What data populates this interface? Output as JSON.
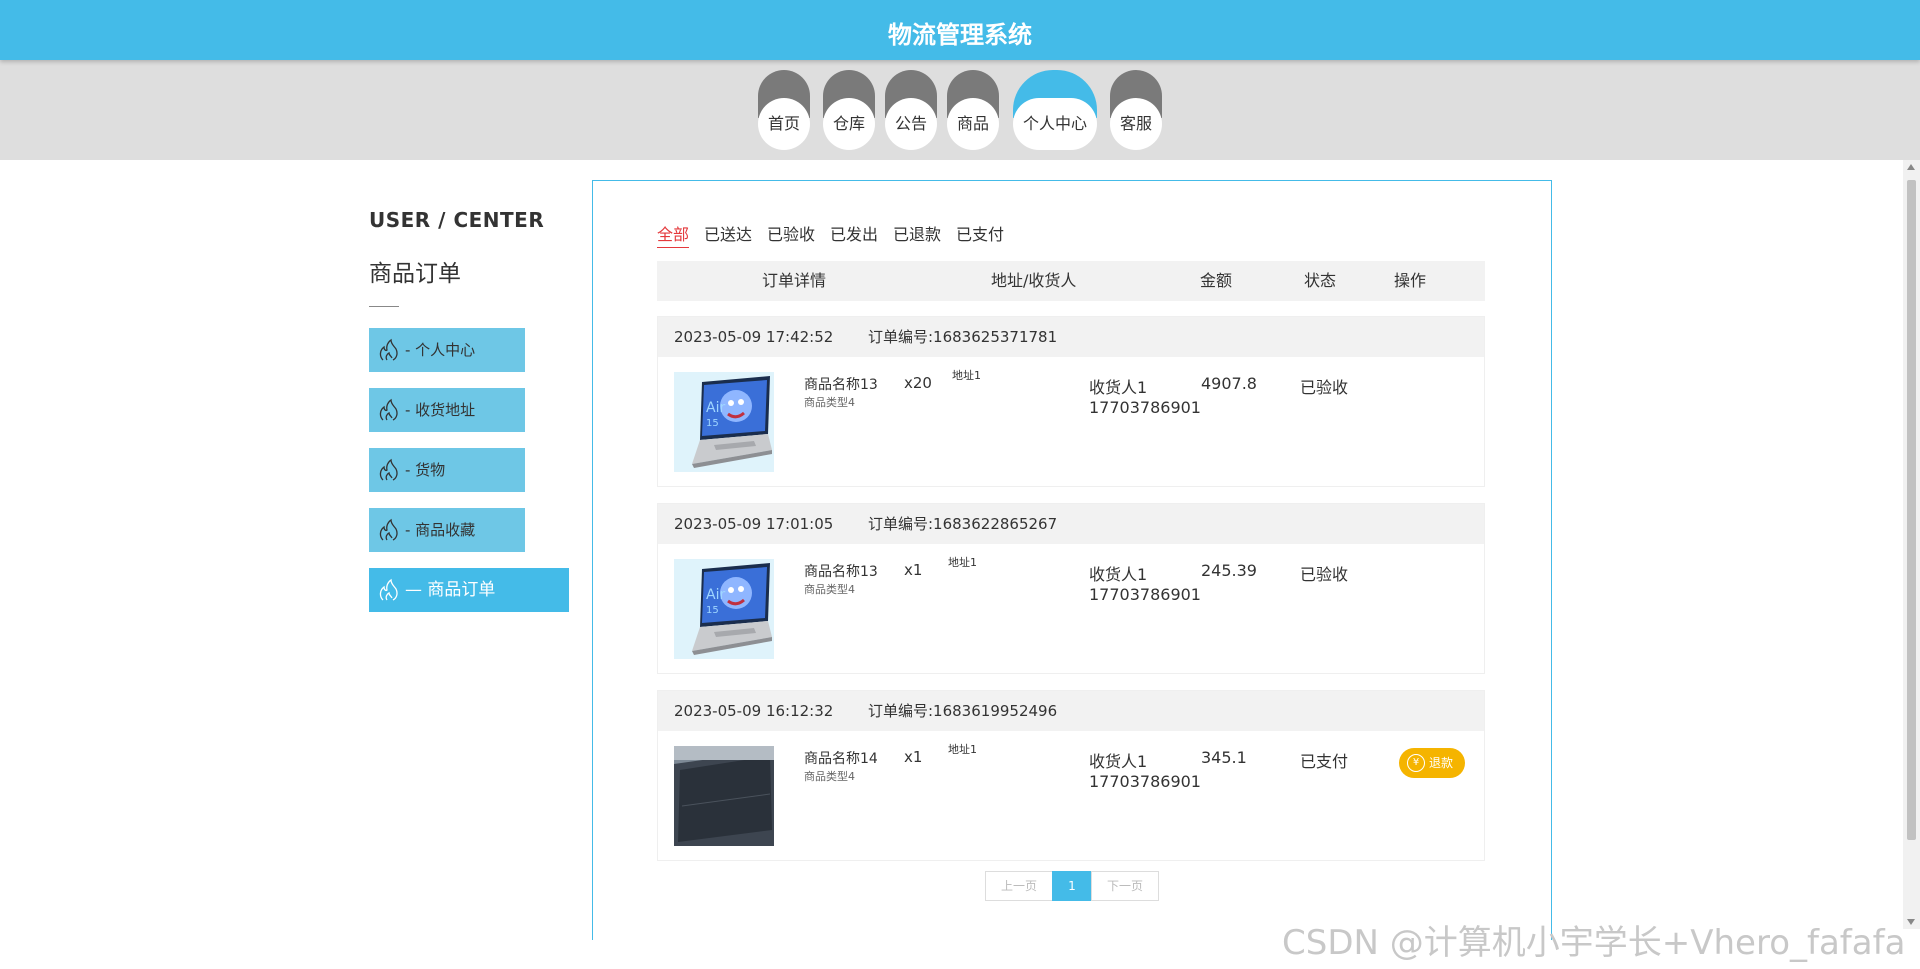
{
  "header": {
    "title": "物流管理系统"
  },
  "nav": {
    "items": [
      {
        "label": "首页"
      },
      {
        "label": "仓库"
      },
      {
        "label": "公告"
      },
      {
        "label": "商品"
      },
      {
        "label": "个人中心",
        "active": true
      },
      {
        "label": "客服"
      }
    ]
  },
  "sidebar": {
    "heading": "USER / CENTER",
    "subheading": "商品订单",
    "items": [
      {
        "label": "- 个人中心"
      },
      {
        "label": "- 收货地址"
      },
      {
        "label": "- 货物"
      },
      {
        "label": "- 商品收藏"
      },
      {
        "label": "— 商品订单",
        "active": true
      }
    ]
  },
  "tabs": [
    "全部",
    "已送达",
    "已验收",
    "已发出",
    "已退款",
    "已支付"
  ],
  "active_tab": "全部",
  "table": {
    "headers": [
      "订单详情",
      "地址/收货人",
      "金额",
      "状态",
      "操作"
    ]
  },
  "orders": [
    {
      "date": "2023-05-09 17:42:52",
      "order_no": "订单编号:1683625371781",
      "product_name": "商品名称13",
      "product_type": "商品类型4",
      "qty": "x20",
      "address": "地址1",
      "receiver": "收货人1",
      "phone": "17703786901",
      "amount": "4907.8",
      "status": "已验收"
    },
    {
      "date": "2023-05-09 17:01:05",
      "order_no": "订单编号:1683622865267",
      "product_name": "商品名称13",
      "product_type": "商品类型4",
      "qty": "x1",
      "address": "地址1",
      "receiver": "收货人1",
      "phone": "17703786901",
      "amount": "245.39",
      "status": "已验收"
    },
    {
      "date": "2023-05-09 16:12:32",
      "order_no": "订单编号:1683619952496",
      "product_name": "商品名称14",
      "product_type": "商品类型4",
      "qty": "x1",
      "address": "地址1",
      "receiver": "收货人1",
      "phone": "17703786901",
      "amount": "345.1",
      "status": "已支付",
      "action": "退款"
    }
  ],
  "pager": {
    "prev": "上一页",
    "current": "1",
    "next": "下一页"
  },
  "watermark": "CSDN @计算机小宇学长+Vhero_fafafa",
  "colors": {
    "primary": "#44bbe8",
    "sidebar": "#6ec7e6",
    "active_tab": "#e4393c",
    "refund": "#f5b400"
  }
}
